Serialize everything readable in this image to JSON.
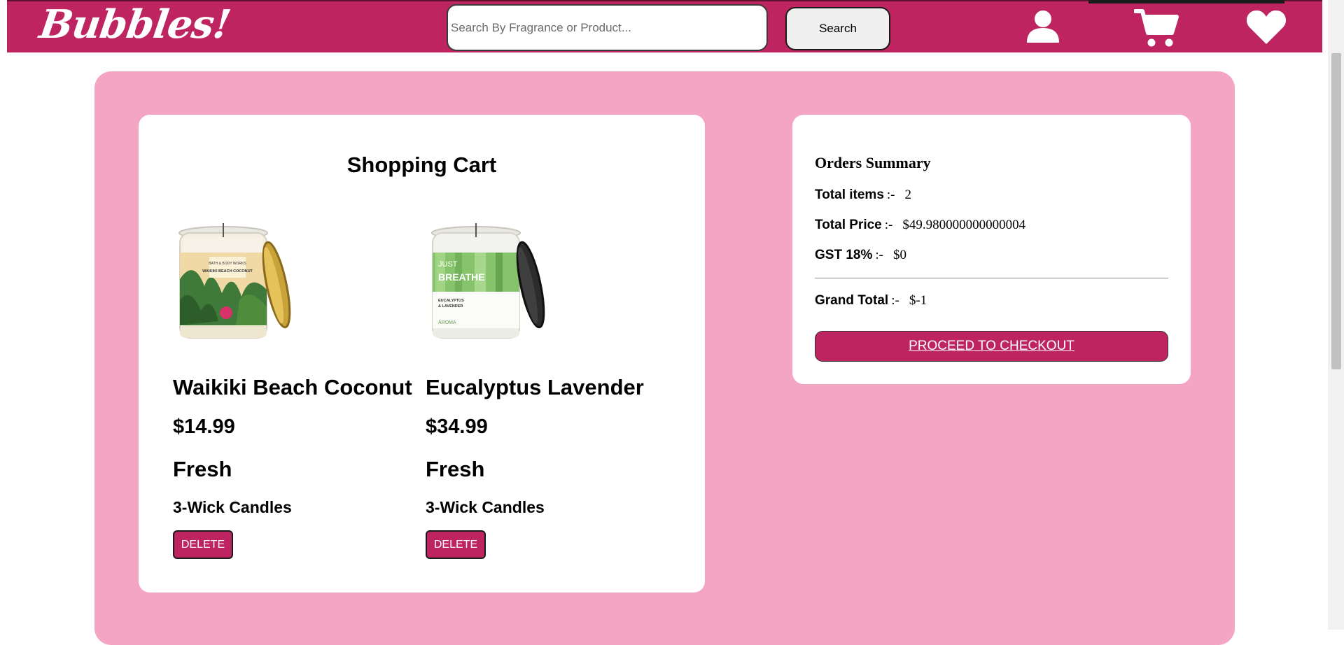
{
  "header": {
    "logo": "Bubbles!",
    "search": {
      "placeholder": "Search By Fragrance or Product...",
      "value": ""
    },
    "search_button": "Search",
    "icons": [
      "user-icon",
      "cart-icon",
      "heart-icon"
    ]
  },
  "cart": {
    "title": "Shopping Cart",
    "items": [
      {
        "name": "Waikiki Beach Coconut",
        "price": "$14.99",
        "scent": "Fresh",
        "category": "3-Wick Candles",
        "delete_label": "DELETE",
        "label_brand": "BATH & BODY WORKS",
        "label_name": "WAIKIKI BEACH COCONUT"
      },
      {
        "name": "Eucalyptus Lavender",
        "price": "$34.99",
        "scent": "Fresh",
        "category": "3-Wick Candles",
        "delete_label": "DELETE",
        "label_tag1": "JUST",
        "label_tag2": "BREATHE",
        "label_line1": "EUCALYPTUS",
        "label_line2": "& LAVENDER",
        "label_footer": "AROMA"
      }
    ]
  },
  "summary": {
    "title": "Orders Summary",
    "rows": [
      {
        "label": "Total items",
        "sep": ":-",
        "value": "2"
      },
      {
        "label": "Total Price",
        "sep": ":-",
        "value": "$49.980000000000004"
      },
      {
        "label": "GST 18%",
        "sep": ":-",
        "value": "$0"
      },
      {
        "label": "Grand Total",
        "sep": ":-",
        "value": "$-1"
      }
    ],
    "checkout_label": "PROCEED TO CHECKOUT"
  },
  "colors": {
    "brand": "#bd2460",
    "panel": "#f3a5c3",
    "card": "#ffffff"
  }
}
